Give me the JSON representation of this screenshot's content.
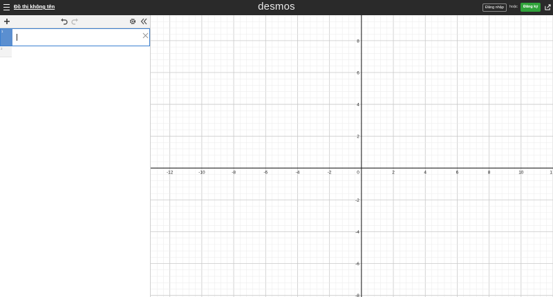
{
  "header": {
    "graph_title": "Đồ thị không tên",
    "brand": "desmos",
    "login_label": "Đăng nhập",
    "or_label": "hoặc",
    "signup_label": "Đăng ký",
    "icons": [
      "hamburger-menu-icon",
      "share-icon"
    ]
  },
  "expression_panel": {
    "toolbar_icons": [
      "add-icon",
      "undo-icon",
      "redo-icon",
      "settings-gear-icon",
      "collapse-panel-icon"
    ],
    "expressions": [
      {
        "index": "1",
        "value": ""
      },
      {
        "index": "2",
        "value": ""
      }
    ]
  },
  "graph": {
    "x_ticks": [
      "-12",
      "-10",
      "-8",
      "-6",
      "-4",
      "-2",
      "0",
      "2",
      "4",
      "6",
      "8",
      "10",
      "1"
    ],
    "y_ticks_positive": [
      "8",
      "6",
      "4",
      "2"
    ],
    "y_ticks_negative": [
      "-2",
      "-4",
      "-6",
      "-8"
    ],
    "x_range": [
      -13.2,
      12
    ],
    "y_range": [
      -8.1,
      9.6
    ],
    "grid_minor_step": 0.4,
    "grid_major_step": 2,
    "colors": {
      "minor": "#eaeaea",
      "major": "#c9c9c9",
      "axis": "#222222",
      "header_bg": "#2a2a2a",
      "signup_bg": "#30a33a",
      "active_row": "#5b8fd0"
    }
  }
}
